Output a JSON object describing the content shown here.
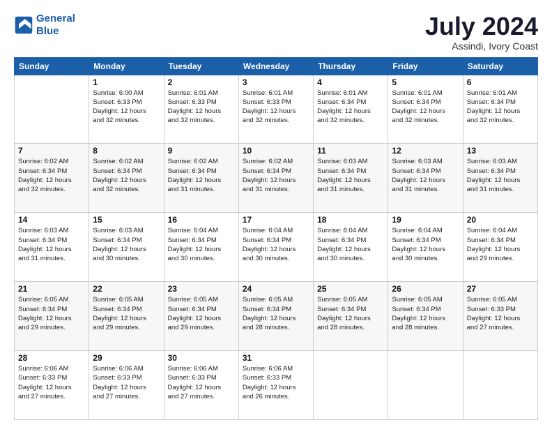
{
  "header": {
    "logo_line1": "General",
    "logo_line2": "Blue",
    "month": "July 2024",
    "location": "Assindi, Ivory Coast"
  },
  "days_of_week": [
    "Sunday",
    "Monday",
    "Tuesday",
    "Wednesday",
    "Thursday",
    "Friday",
    "Saturday"
  ],
  "weeks": [
    [
      {
        "day": "",
        "info": ""
      },
      {
        "day": "1",
        "info": "Sunrise: 6:00 AM\nSunset: 6:33 PM\nDaylight: 12 hours\nand 32 minutes."
      },
      {
        "day": "2",
        "info": "Sunrise: 6:01 AM\nSunset: 6:33 PM\nDaylight: 12 hours\nand 32 minutes."
      },
      {
        "day": "3",
        "info": "Sunrise: 6:01 AM\nSunset: 6:33 PM\nDaylight: 12 hours\nand 32 minutes."
      },
      {
        "day": "4",
        "info": "Sunrise: 6:01 AM\nSunset: 6:34 PM\nDaylight: 12 hours\nand 32 minutes."
      },
      {
        "day": "5",
        "info": "Sunrise: 6:01 AM\nSunset: 6:34 PM\nDaylight: 12 hours\nand 32 minutes."
      },
      {
        "day": "6",
        "info": "Sunrise: 6:01 AM\nSunset: 6:34 PM\nDaylight: 12 hours\nand 32 minutes."
      }
    ],
    [
      {
        "day": "7",
        "info": "Sunrise: 6:02 AM\nSunset: 6:34 PM\nDaylight: 12 hours\nand 32 minutes."
      },
      {
        "day": "8",
        "info": "Sunrise: 6:02 AM\nSunset: 6:34 PM\nDaylight: 12 hours\nand 32 minutes."
      },
      {
        "day": "9",
        "info": "Sunrise: 6:02 AM\nSunset: 6:34 PM\nDaylight: 12 hours\nand 31 minutes."
      },
      {
        "day": "10",
        "info": "Sunrise: 6:02 AM\nSunset: 6:34 PM\nDaylight: 12 hours\nand 31 minutes."
      },
      {
        "day": "11",
        "info": "Sunrise: 6:03 AM\nSunset: 6:34 PM\nDaylight: 12 hours\nand 31 minutes."
      },
      {
        "day": "12",
        "info": "Sunrise: 6:03 AM\nSunset: 6:34 PM\nDaylight: 12 hours\nand 31 minutes."
      },
      {
        "day": "13",
        "info": "Sunrise: 6:03 AM\nSunset: 6:34 PM\nDaylight: 12 hours\nand 31 minutes."
      }
    ],
    [
      {
        "day": "14",
        "info": "Sunrise: 6:03 AM\nSunset: 6:34 PM\nDaylight: 12 hours\nand 31 minutes."
      },
      {
        "day": "15",
        "info": "Sunrise: 6:03 AM\nSunset: 6:34 PM\nDaylight: 12 hours\nand 30 minutes."
      },
      {
        "day": "16",
        "info": "Sunrise: 6:04 AM\nSunset: 6:34 PM\nDaylight: 12 hours\nand 30 minutes."
      },
      {
        "day": "17",
        "info": "Sunrise: 6:04 AM\nSunset: 6:34 PM\nDaylight: 12 hours\nand 30 minutes."
      },
      {
        "day": "18",
        "info": "Sunrise: 6:04 AM\nSunset: 6:34 PM\nDaylight: 12 hours\nand 30 minutes."
      },
      {
        "day": "19",
        "info": "Sunrise: 6:04 AM\nSunset: 6:34 PM\nDaylight: 12 hours\nand 30 minutes."
      },
      {
        "day": "20",
        "info": "Sunrise: 6:04 AM\nSunset: 6:34 PM\nDaylight: 12 hours\nand 29 minutes."
      }
    ],
    [
      {
        "day": "21",
        "info": "Sunrise: 6:05 AM\nSunset: 6:34 PM\nDaylight: 12 hours\nand 29 minutes."
      },
      {
        "day": "22",
        "info": "Sunrise: 6:05 AM\nSunset: 6:34 PM\nDaylight: 12 hours\nand 29 minutes."
      },
      {
        "day": "23",
        "info": "Sunrise: 6:05 AM\nSunset: 6:34 PM\nDaylight: 12 hours\nand 29 minutes."
      },
      {
        "day": "24",
        "info": "Sunrise: 6:05 AM\nSunset: 6:34 PM\nDaylight: 12 hours\nand 28 minutes."
      },
      {
        "day": "25",
        "info": "Sunrise: 6:05 AM\nSunset: 6:34 PM\nDaylight: 12 hours\nand 28 minutes."
      },
      {
        "day": "26",
        "info": "Sunrise: 6:05 AM\nSunset: 6:34 PM\nDaylight: 12 hours\nand 28 minutes."
      },
      {
        "day": "27",
        "info": "Sunrise: 6:05 AM\nSunset: 6:33 PM\nDaylight: 12 hours\nand 27 minutes."
      }
    ],
    [
      {
        "day": "28",
        "info": "Sunrise: 6:06 AM\nSunset: 6:33 PM\nDaylight: 12 hours\nand 27 minutes."
      },
      {
        "day": "29",
        "info": "Sunrise: 6:06 AM\nSunset: 6:33 PM\nDaylight: 12 hours\nand 27 minutes."
      },
      {
        "day": "30",
        "info": "Sunrise: 6:06 AM\nSunset: 6:33 PM\nDaylight: 12 hours\nand 27 minutes."
      },
      {
        "day": "31",
        "info": "Sunrise: 6:06 AM\nSunset: 6:33 PM\nDaylight: 12 hours\nand 26 minutes."
      },
      {
        "day": "",
        "info": ""
      },
      {
        "day": "",
        "info": ""
      },
      {
        "day": "",
        "info": ""
      }
    ]
  ]
}
